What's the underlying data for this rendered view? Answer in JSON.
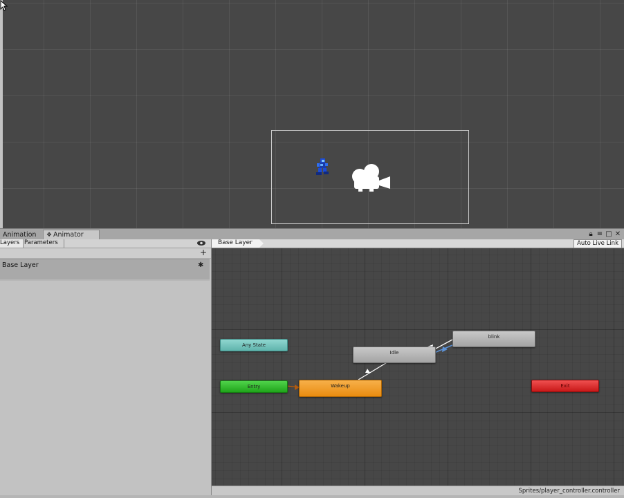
{
  "tabs": {
    "animation": "Animation",
    "animator": "Animator"
  },
  "left_panel": {
    "tabs": {
      "layers": "Layers",
      "parameters": "Parameters"
    },
    "add_label": "+",
    "layers": [
      {
        "name": "Base Layer"
      }
    ]
  },
  "graph": {
    "breadcrumb": "Base Layer",
    "auto_live_link": "Auto Live Link",
    "asset_path": "Sprites/player_controller.controller",
    "states": {
      "any_state": "Any State",
      "entry": "Entry",
      "wakeup": "Wakeup",
      "idle": "Idle",
      "blink": "blink",
      "exit": "Exit"
    }
  },
  "colors": {
    "any_state": "#6cc2ba",
    "entry": "#2cb826",
    "default_state": "#f09a22",
    "state": "#b6b6b6",
    "exit": "#dd2a2a",
    "selected_transition": "#5d93d8"
  },
  "icons": {
    "cursor": "arrow-cursor-icon",
    "camera": "camera-gizmo-icon",
    "animator_tab": "animator-icon",
    "eye": "eye-icon",
    "gear": "gear-icon",
    "lock": "lock-icon",
    "menu": "menu-icon",
    "maximize": "maximize-icon",
    "close": "close-icon"
  }
}
